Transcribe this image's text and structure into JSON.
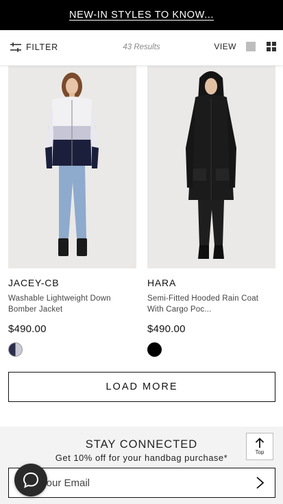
{
  "promo": {
    "text": "NEW-IN STYLES TO KNOW..."
  },
  "toolbar": {
    "filter_label": "FILTER",
    "results_label": "43 Results",
    "view_label": "VIEW",
    "filter_icon": "sliders-icon",
    "view_single_icon": "single-view-icon",
    "view_grid_icon": "grid-view-icon"
  },
  "products": [
    {
      "name": "JACEY-CB",
      "description": "Washable Lightweight Down Bomber Jacket",
      "price": "$490.00",
      "swatches": [
        "navy / white"
      ]
    },
    {
      "name": "HARA",
      "description": "Semi-Fitted Hooded Rain Coat With Cargo Poc...",
      "price": "$490.00",
      "swatches": [
        "black"
      ]
    }
  ],
  "load_more": {
    "label": "LOAD MORE"
  },
  "footer": {
    "title": "STAY CONNECTED",
    "subtitle": "Get 10% off for your handbag purchase*",
    "email_placeholder": "Your Email",
    "top_label": "Top"
  },
  "colors": {
    "promo_bg": "#000000",
    "footer_bg": "#f3f3f3",
    "image_bg": "#eae9e7",
    "chat_bg": "#2a2a2a"
  }
}
